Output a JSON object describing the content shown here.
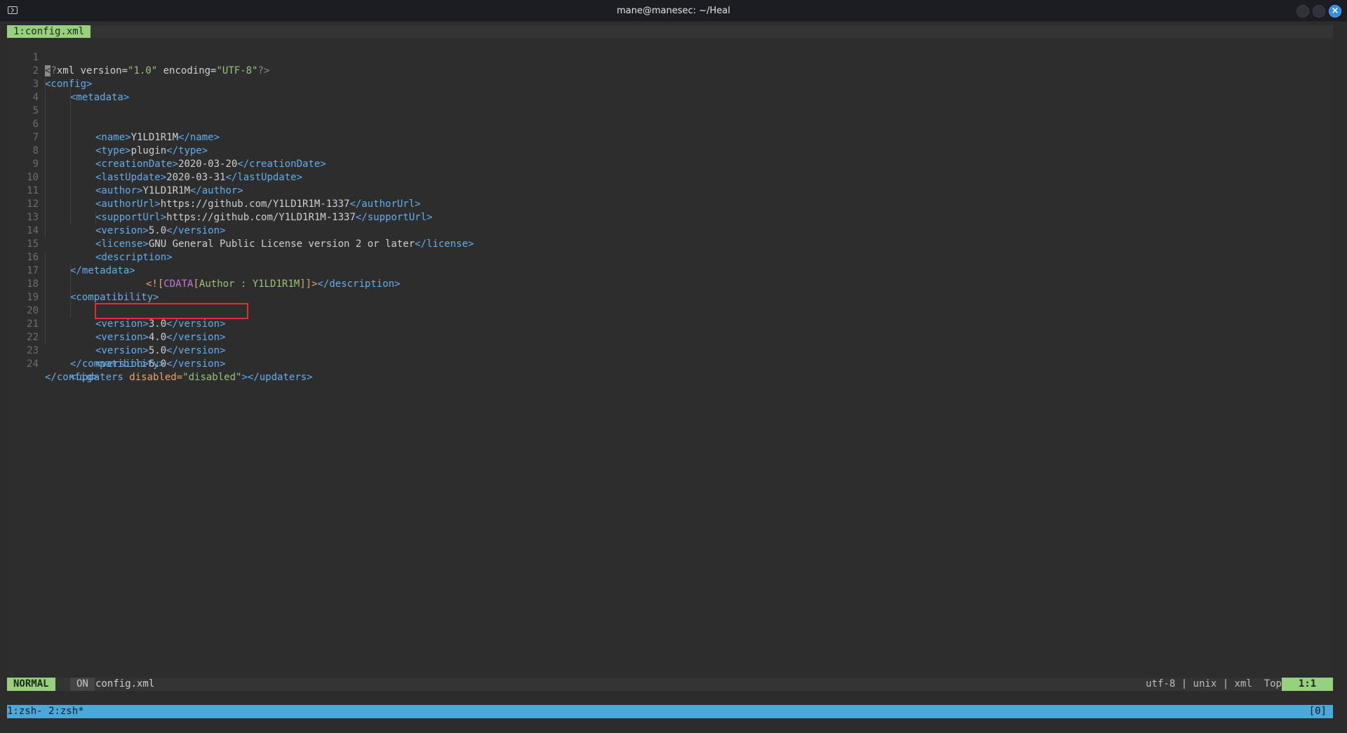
{
  "window": {
    "title": "mane@manesec: ~/Heal",
    "icons": {
      "app": "terminal-icon",
      "minimize": "circle-icon",
      "maximize": "circle-icon",
      "close": "close-icon"
    },
    "close_glyph": "×"
  },
  "tabline": {
    "active_tab": "1:config.xml"
  },
  "editor": {
    "line_numbers": [
      "1",
      "2",
      "3",
      "4",
      "5",
      "6",
      "7",
      "8",
      "9",
      "10",
      "11",
      "12",
      "13",
      "14",
      "15",
      "16",
      "17",
      "18",
      "19",
      "20",
      "21",
      "22",
      "23",
      "24"
    ],
    "lines": [
      {
        "cursor": "<",
        "a": "?",
        "b": "xml version=",
        "c": "\"1.0\"",
        "d": " encoding=",
        "e": "\"UTF-8\"",
        "f": "?>"
      },
      {
        "tag": "<config>"
      },
      {
        "tag": "<metadata>"
      },
      {
        "open": "<name>",
        "text": "Y1LD1R1M",
        "close": "</name>"
      },
      {
        "open": "<type>",
        "text": "plugin",
        "close": "</type>"
      },
      {
        "open": "<creationDate>",
        "text": "2020-03-20",
        "close": "</creationDate>"
      },
      {
        "open": "<lastUpdate>",
        "text": "2020-03-31",
        "close": "</lastUpdate>"
      },
      {
        "open": "<author>",
        "text": "Y1LD1R1M",
        "close": "</author>"
      },
      {
        "open": "<authorUrl>",
        "text": "https://github.com/Y1LD1R1M-1337",
        "close": "</authorUrl>"
      },
      {
        "open": "<supportUrl>",
        "text": "https://github.com/Y1LD1R1M-1337",
        "close": "</supportUrl>"
      },
      {
        "open": "<version>",
        "text": "5.0",
        "close": "</version>"
      },
      {
        "open": "<license>",
        "text": "GNU General Public License version 2 or later",
        "close": "</license>"
      },
      {
        "tag": "<description>"
      },
      {
        "a": "<![",
        "b": "CDATA",
        "c": "[",
        "d": "Author : Y1LD1R1M",
        "e": "]]>",
        "f": "</description>"
      },
      {
        "tag": "</metadata>"
      },
      {
        "tag": ""
      },
      {
        "tag": "<compatibility>"
      },
      {
        "open": "<version>",
        "text": "3.0",
        "close": "</version>"
      },
      {
        "open": "<version>",
        "text": "4.0",
        "close": "</version>"
      },
      {
        "open": "<version>",
        "text": "5.0",
        "close": "</version>"
      },
      {
        "open": "<version>",
        "text": "6.0",
        "close": "</version>"
      },
      {
        "tag": "</compatibility>"
      },
      {
        "a": "<updaters ",
        "b": "disabled=",
        "c": "\"disabled\"",
        "d": ">",
        "e": "</updaters>"
      },
      {
        "tag": "</config>"
      }
    ]
  },
  "statusline": {
    "mode": "NORMAL",
    "paste": "ON",
    "filename": "config.xml",
    "fileinfo": "utf-8 | unix | xml  Top",
    "position": "1:1"
  },
  "tmux": {
    "windows": "1:zsh- 2:zsh*",
    "session": "[0]"
  },
  "colors": {
    "accent_green": "#98d17d",
    "tmux_blue": "#4aa9d9",
    "highlight_red": "#e52d2d"
  }
}
